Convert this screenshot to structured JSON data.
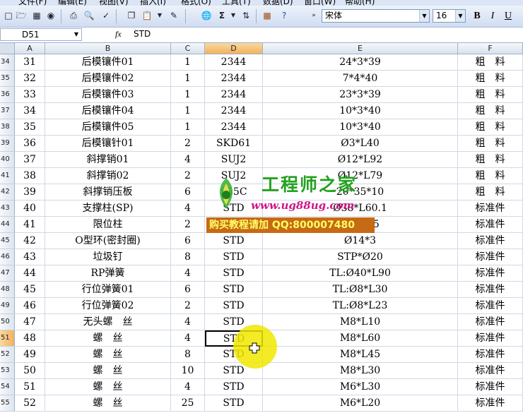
{
  "menu": [
    "文件(F)",
    "编辑(E)",
    "视图(V)",
    "插入(I)",
    "格式(O)",
    "工具(T)",
    "数据(D)",
    "窗口(W)",
    "帮助(H)"
  ],
  "toolbar": {
    "sigma": "Σ",
    "font_name": "宋体",
    "font_size": "16",
    "bold": "B",
    "italic": "I",
    "underline": "U"
  },
  "formula_bar": {
    "name_box": "D51",
    "fx": "fx",
    "value": "STD"
  },
  "columns": [
    "A",
    "B",
    "C",
    "D",
    "E",
    "F"
  ],
  "rows": [
    {
      "n": "34",
      "a": "31",
      "b": "后模镶件01",
      "c": "1",
      "d": "2344",
      "e": "24*3*39",
      "f": "粗　料"
    },
    {
      "n": "35",
      "a": "32",
      "b": "后模镶件02",
      "c": "1",
      "d": "2344",
      "e": "7*4*40",
      "f": "粗　料"
    },
    {
      "n": "36",
      "a": "33",
      "b": "后模镶件03",
      "c": "1",
      "d": "2344",
      "e": "23*3*39",
      "f": "粗　料"
    },
    {
      "n": "37",
      "a": "34",
      "b": "后模镶件04",
      "c": "1",
      "d": "2344",
      "e": "10*3*40",
      "f": "粗　料"
    },
    {
      "n": "38",
      "a": "35",
      "b": "后模镶件05",
      "c": "1",
      "d": "2344",
      "e": "10*3*40",
      "f": "粗　料"
    },
    {
      "n": "39",
      "a": "36",
      "b": "后模镶针01",
      "c": "2",
      "d": "SKD61",
      "e": "Ø3*L40",
      "f": "粗　料"
    },
    {
      "n": "40",
      "a": "37",
      "b": "斜撑销01",
      "c": "4",
      "d": "SUJ2",
      "e": "Ø12*L92",
      "f": "粗　料"
    },
    {
      "n": "41",
      "a": "38",
      "b": "斜撑销02",
      "c": "2",
      "d": "SUJ2",
      "e": "Ø12*L79",
      "f": "粗　料"
    },
    {
      "n": "42",
      "a": "39",
      "b": "斜撑销压板",
      "c": "6",
      "d": "S55C",
      "e": "20*35*10",
      "f": "粗　料"
    },
    {
      "n": "43",
      "a": "40",
      "b": "支撑柱(SP)",
      "c": "4",
      "d": "STD",
      "e": "Ø38*L60.1",
      "f": "标准件"
    },
    {
      "n": "44",
      "a": "41",
      "b": "限位柱",
      "c": "2",
      "d": "STD",
      "e": "Ø5*L25",
      "f": "标准件"
    },
    {
      "n": "45",
      "a": "42",
      "b": "O型环(密封圈)",
      "c": "6",
      "d": "STD",
      "e": "Ø14*3",
      "f": "标准件"
    },
    {
      "n": "46",
      "a": "43",
      "b": "垃圾钉",
      "c": "8",
      "d": "STD",
      "e": "STP*Ø20",
      "f": "标准件"
    },
    {
      "n": "47",
      "a": "44",
      "b": "RP弹簧",
      "c": "4",
      "d": "STD",
      "e": "TL:Ø40*L90",
      "f": "标准件"
    },
    {
      "n": "48",
      "a": "45",
      "b": "行位弹簧01",
      "c": "6",
      "d": "STD",
      "e": "TL:Ø8*L30",
      "f": "标准件"
    },
    {
      "n": "49",
      "a": "46",
      "b": "行位弹簧02",
      "c": "2",
      "d": "STD",
      "e": "TL:Ø8*L23",
      "f": "标准件"
    },
    {
      "n": "50",
      "a": "47",
      "b": "无头螺　丝",
      "c": "4",
      "d": "STD",
      "e": "M8*L10",
      "f": "标准件"
    },
    {
      "n": "51",
      "a": "48",
      "b": "螺　丝",
      "c": "4",
      "d": "STD",
      "e": "M8*L60",
      "f": "标准件"
    },
    {
      "n": "52",
      "a": "49",
      "b": "螺　丝",
      "c": "8",
      "d": "STD",
      "e": "M8*L45",
      "f": "标准件"
    },
    {
      "n": "53",
      "a": "50",
      "b": "螺　丝",
      "c": "10",
      "d": "STD",
      "e": "M8*L30",
      "f": "标准件"
    },
    {
      "n": "54",
      "a": "51",
      "b": "螺　丝",
      "c": "4",
      "d": "STD",
      "e": "M6*L30",
      "f": "标准件"
    },
    {
      "n": "55",
      "a": "52",
      "b": "螺　丝",
      "c": "25",
      "d": "STD",
      "e": "M6*L20",
      "f": "标准件"
    }
  ],
  "active_cell": {
    "row": "51",
    "col": "D"
  },
  "watermark": {
    "title": "工程师之家",
    "url": "www.ug88ug.com",
    "buy": "购买教程请加 QQ:800007480"
  },
  "colors": {
    "selected_header": "#f1b25f",
    "watermark_green": "#22a21e",
    "watermark_pink": "#d0148a",
    "watermark_banner": "#c76a14"
  }
}
